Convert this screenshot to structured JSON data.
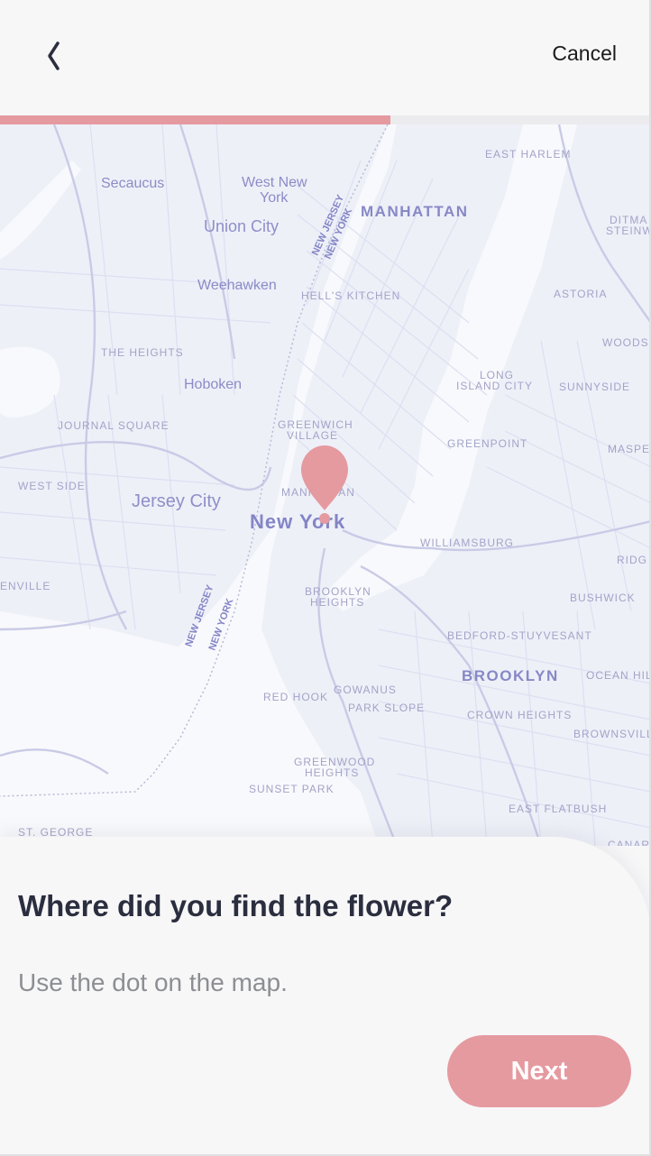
{
  "header": {
    "back_icon": "chevron-left-icon",
    "cancel_label": "Cancel"
  },
  "progress": {
    "fraction": 0.6,
    "color": "#e59aa0"
  },
  "map": {
    "pin_icon": "map-pin-icon",
    "pin_color": "#e59aa0",
    "labels": {
      "secaucus": "Secaucus",
      "west_new_york_1": "West New",
      "west_new_york_2": "York",
      "union_city": "Union City",
      "weehawken": "Weehawken",
      "the_heights": "THE HEIGHTS",
      "hoboken": "Hoboken",
      "journal_square": "JOURNAL SQUARE",
      "west_side": "WEST SIDE",
      "jersey_city": "Jersey City",
      "enville": "ENVILLE",
      "east_harlem": "EAST HARLEM",
      "manhattan": "MANHATTAN",
      "ditmars_1": "DITMA",
      "ditmars_2": "STEINW",
      "hells_kitchen": "HELL'S KITCHEN",
      "astoria": "ASTORIA",
      "woodside": "WOODS",
      "long_island_city_1": "LONG",
      "long_island_city_2": "ISLAND CITY",
      "sunnyside": "SUNNYSIDE",
      "greenwich_village_1": "GREENWICH",
      "greenwich_village_2": "VILLAGE",
      "greenpoint": "GREENPOINT",
      "maspeth": "MASPE",
      "manhattan_small": "MANHATTAN",
      "new_york": "New York",
      "williamsburg": "WILLIAMSBURG",
      "ridgewood": "RIDG",
      "brooklyn_heights_1": "BROOKLYN",
      "brooklyn_heights_2": "HEIGHTS",
      "bushwick": "BUSHWICK",
      "bedford_stuyvesant": "BEDFORD-STUYVESANT",
      "brooklyn": "BROOKLYN",
      "ocean_hill": "OCEAN HIL",
      "red_hook": "RED HOOK",
      "gowanus": "GOWANUS",
      "park_slope": "PARK SLOPE",
      "crown_heights": "CROWN HEIGHTS",
      "brownsville": "BROWNSVILL",
      "greenwood_heights_1": "GREENWOOD",
      "greenwood_heights_2": "HEIGHTS",
      "sunset_park": "SUNSET PARK",
      "east_flatbush": "EAST FLATBUSH",
      "st_george": "ST. GEORGE",
      "canarsie": "CANAR",
      "nj_ny_top_1": "NEW JERSEY",
      "nj_ny_top_2": "NEW YORK",
      "nj_ny_bottom_1": "NEW JERSEY",
      "nj_ny_bottom_2": "NEW YORK"
    }
  },
  "sheet": {
    "question": "Where did you find the flower?",
    "hint": "Use the dot on the map.",
    "next_label": "Next"
  }
}
